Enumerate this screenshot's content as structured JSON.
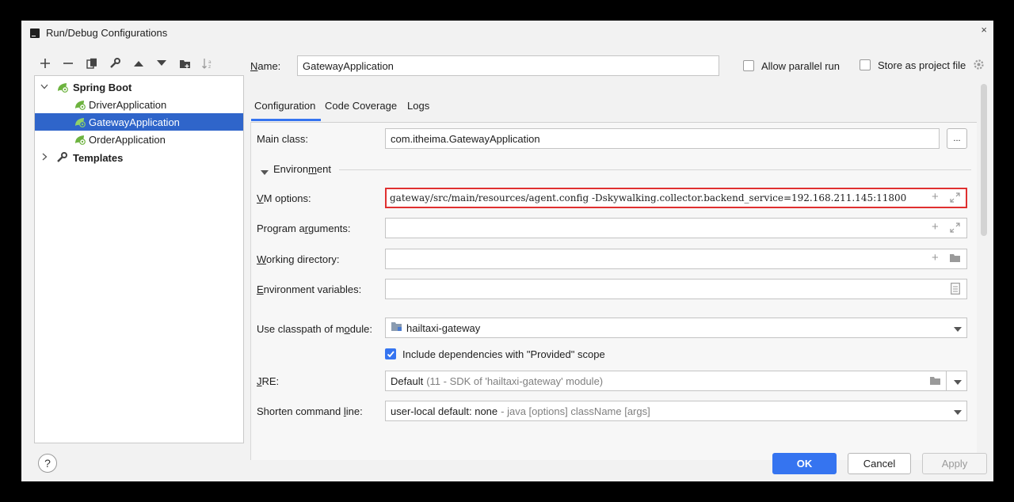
{
  "window": {
    "title": "Run/Debug Configurations",
    "close_glyph": "×"
  },
  "toolbar": {
    "icons": [
      "add-icon",
      "remove-icon",
      "copy-icon",
      "wrench-icon",
      "move-up-icon",
      "move-down-icon",
      "folder-icon",
      "sort-icon"
    ]
  },
  "tree": {
    "group": "Spring Boot",
    "items": [
      {
        "label": "DriverApplication",
        "selected": false
      },
      {
        "label": "GatewayApplication",
        "selected": true
      },
      {
        "label": "OrderApplication",
        "selected": false
      }
    ],
    "templates": "Templates"
  },
  "header": {
    "name_label": "Name:",
    "name_value": "GatewayApplication",
    "allow_parallel": "Allow parallel run",
    "store_project": "Store as project file"
  },
  "tabs": [
    "Configuration",
    "Code Coverage",
    "Logs"
  ],
  "form": {
    "main_class_label": "Main class:",
    "main_class_value": "com.itheima.GatewayApplication",
    "browse_label": "...",
    "environment_label": "Environment",
    "vm_label": "VM options:",
    "vm_value": "gateway/src/main/resources/agent.config -Dskywalking.collector.backend_service=192.168.211.145:11800",
    "program_args_label": "Program arguments:",
    "working_dir_label": "Working directory:",
    "env_vars_label": "Environment variables:",
    "classpath_label": "Use classpath of module:",
    "classpath_value": "hailtaxi-gateway",
    "include_deps": "Include dependencies with \"Provided\" scope",
    "include_deps_checked": true,
    "jre_label": "JRE:",
    "jre_value": "Default",
    "jre_hint": "(11 - SDK of 'hailtaxi-gateway' module)",
    "shorten_label": "Shorten command line:",
    "shorten_value": "user-local default: none",
    "shorten_hint": "- java [options] className [args]"
  },
  "footer": {
    "help": "?",
    "ok": "OK",
    "cancel": "Cancel",
    "apply": "Apply"
  },
  "colors": {
    "accent": "#3574f0",
    "selection": "#2f65ca",
    "highlight_border": "#e03030",
    "spring": "#6db33f"
  }
}
